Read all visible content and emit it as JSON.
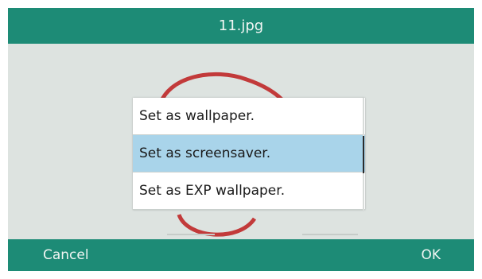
{
  "title": "11.jpg",
  "menu": {
    "items": [
      {
        "label": "Set as wallpaper."
      },
      {
        "label": "Set as screensaver."
      },
      {
        "label": "Set as EXP wallpaper."
      }
    ],
    "selected_index": 1
  },
  "softkeys": {
    "left": "Cancel",
    "right": "OK"
  },
  "colors": {
    "bar": "#1d8b76",
    "selection": "#a9d4ea"
  }
}
